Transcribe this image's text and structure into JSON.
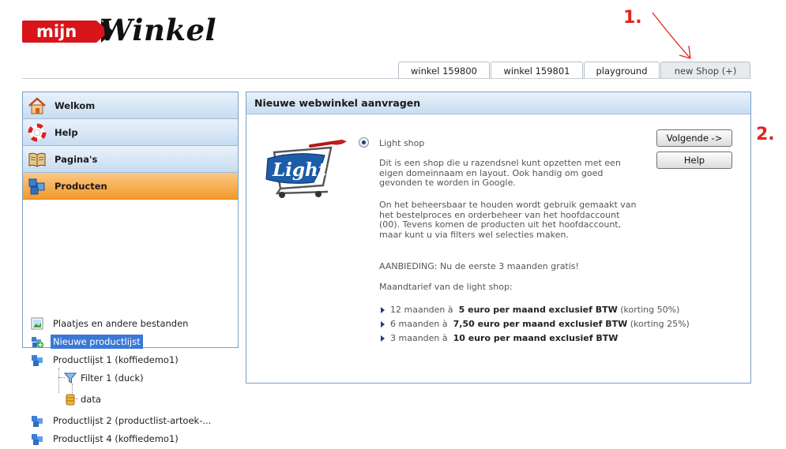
{
  "logo": {
    "prefix": "mijn",
    "name": "Winkel"
  },
  "annotations": {
    "step1": "1.",
    "step2": "2."
  },
  "tabs": [
    {
      "label": "winkel 159800"
    },
    {
      "label": "winkel 159801"
    },
    {
      "label": "playground"
    },
    {
      "label": "new Shop (+)"
    }
  ],
  "sidebar": {
    "nav": [
      {
        "label": "Welkom",
        "icon": "home-icon"
      },
      {
        "label": "Help",
        "icon": "lifebuoy-icon"
      },
      {
        "label": "Pagina's",
        "icon": "book-icon"
      },
      {
        "label": "Producten",
        "icon": "products-icon"
      }
    ],
    "tree": [
      {
        "label": "Plaatjes en andere bestanden",
        "icon": "image-icon"
      },
      {
        "label": "Nieuwe productlijst",
        "icon": "add-productlist-icon"
      },
      {
        "label": "Productlijst 1 (koffiedemo1)",
        "icon": "productlist-icon"
      },
      {
        "label": "Filter 1 (duck)",
        "icon": "filter-icon"
      },
      {
        "label": "data",
        "icon": "database-icon"
      },
      {
        "label": "Productlijst 2 (productlist-artoek-...",
        "icon": "productlist-icon"
      },
      {
        "label": "Productlijst 4 (koffiedemo1)",
        "icon": "productlist-icon"
      }
    ]
  },
  "main": {
    "title": "Nieuwe webwinkel aanvragen",
    "option_label": "Light shop",
    "logo_text": "Light",
    "paragraphs": [
      "Dit is een shop die u razendsnel kunt opzetten met een eigen domeinnaam en layout. Ook handig om goed gevonden te worden in Google.",
      "On het beheersbaar te houden wordt gebruik gemaakt van het bestelproces en orderbeheer van het hoofdaccount (00). Tevens komen de producten uit het hoofdaccount, maar kunt u via filters wel selecties maken.",
      "AANBIEDING: Nu de eerste 3 maanden gratis!",
      "Maandtarief van de light shop:"
    ],
    "prices": [
      {
        "prefix": "12 maanden à",
        "bold": "5 euro per maand exclusief BTW",
        "suffix": "(korting 50%)"
      },
      {
        "prefix": "6 maanden à",
        "bold": "7,50 euro per maand exclusief BTW",
        "suffix": "(korting 25%)"
      },
      {
        "prefix": "3 maanden à",
        "bold": "10 euro per maand exclusief BTW",
        "suffix": ""
      }
    ],
    "buttons": {
      "next": "Volgende ->",
      "help": "Help"
    }
  }
}
